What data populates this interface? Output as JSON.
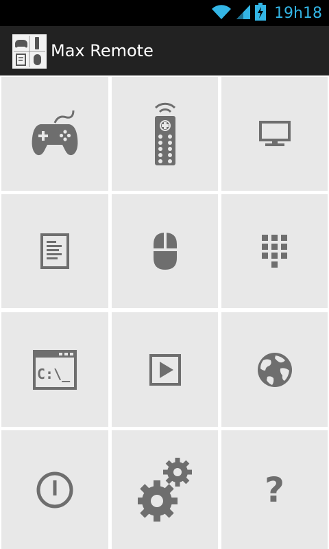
{
  "status_bar": {
    "time": "19h18",
    "icons": [
      "wifi-icon",
      "signal-icon",
      "battery-charging-icon"
    ],
    "accent_color": "#33b5e5"
  },
  "action_bar": {
    "title": "Max Remote",
    "icon": "max-remote-app-icon"
  },
  "tiles": [
    {
      "icon": "gamepad-icon"
    },
    {
      "icon": "remote-control-icon"
    },
    {
      "icon": "monitor-icon"
    },
    {
      "icon": "document-icon"
    },
    {
      "icon": "mouse-icon"
    },
    {
      "icon": "keypad-icon"
    },
    {
      "icon": "command-prompt-icon",
      "glyph": "C:\\_"
    },
    {
      "icon": "play-icon"
    },
    {
      "icon": "globe-icon"
    },
    {
      "icon": "power-icon"
    },
    {
      "icon": "settings-gears-icon"
    },
    {
      "icon": "help-icon",
      "glyph": "?"
    }
  ],
  "colors": {
    "tile_background": "#e8e8e8",
    "icon_gray": "#6e6e6e",
    "action_bar": "#222222"
  }
}
